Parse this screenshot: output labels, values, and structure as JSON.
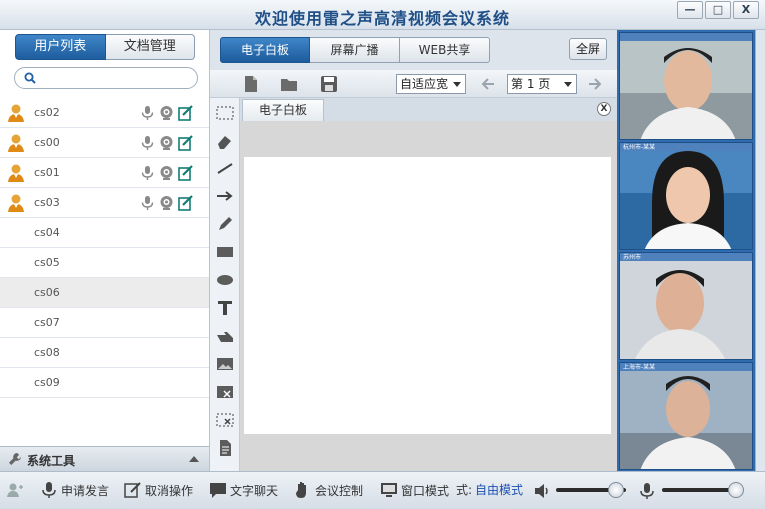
{
  "window": {
    "title": "欢迎使用雷之声高清视频会议系统",
    "min_label": "—",
    "max_label": "□",
    "close_label": "X"
  },
  "left": {
    "tabs": [
      {
        "label": "用户列表",
        "active": true
      },
      {
        "label": "文档管理",
        "active": false
      }
    ],
    "search": {
      "value": "",
      "placeholder": ""
    },
    "users": [
      {
        "name": "cs02",
        "online": true
      },
      {
        "name": "cs00",
        "online": true
      },
      {
        "name": "cs01",
        "online": true
      },
      {
        "name": "cs03",
        "online": true
      },
      {
        "name": "cs04",
        "online": false
      },
      {
        "name": "cs05",
        "online": false
      },
      {
        "name": "cs06",
        "online": false,
        "selected": true
      },
      {
        "name": "cs07",
        "online": false
      },
      {
        "name": "cs08",
        "online": false
      },
      {
        "name": "cs09",
        "online": false
      }
    ],
    "system_tools_label": "系统工具"
  },
  "center": {
    "tabs": [
      {
        "label": "电子白板",
        "active": true
      },
      {
        "label": "屏幕广播",
        "active": false
      },
      {
        "label": "WEB共享",
        "active": false
      }
    ],
    "fullscreen_label": "全屏",
    "zoom_value": "自适应宽",
    "page_value": "第 1 页",
    "whiteboard_tab_label": "电子白板",
    "close_label": "X"
  },
  "videos": [
    {
      "caption": ""
    },
    {
      "caption": "杭州市-某某"
    },
    {
      "caption": "苏州市"
    },
    {
      "caption": "上海市-某某"
    }
  ],
  "bottom": {
    "request_speak": "申请发言",
    "cancel_op": "取消操作",
    "text_chat": "文字聊天",
    "meeting_control": "会议控制",
    "window_mode": "窗口模式",
    "mode_prefix": "式:",
    "free_mode": "自由模式",
    "speaker_volume": 0.85,
    "mic_volume": 0.95
  },
  "colors": {
    "accent_blue": "#1e5d9e",
    "video_panel": "#2f6db0",
    "title_text": "#1f4f86"
  }
}
